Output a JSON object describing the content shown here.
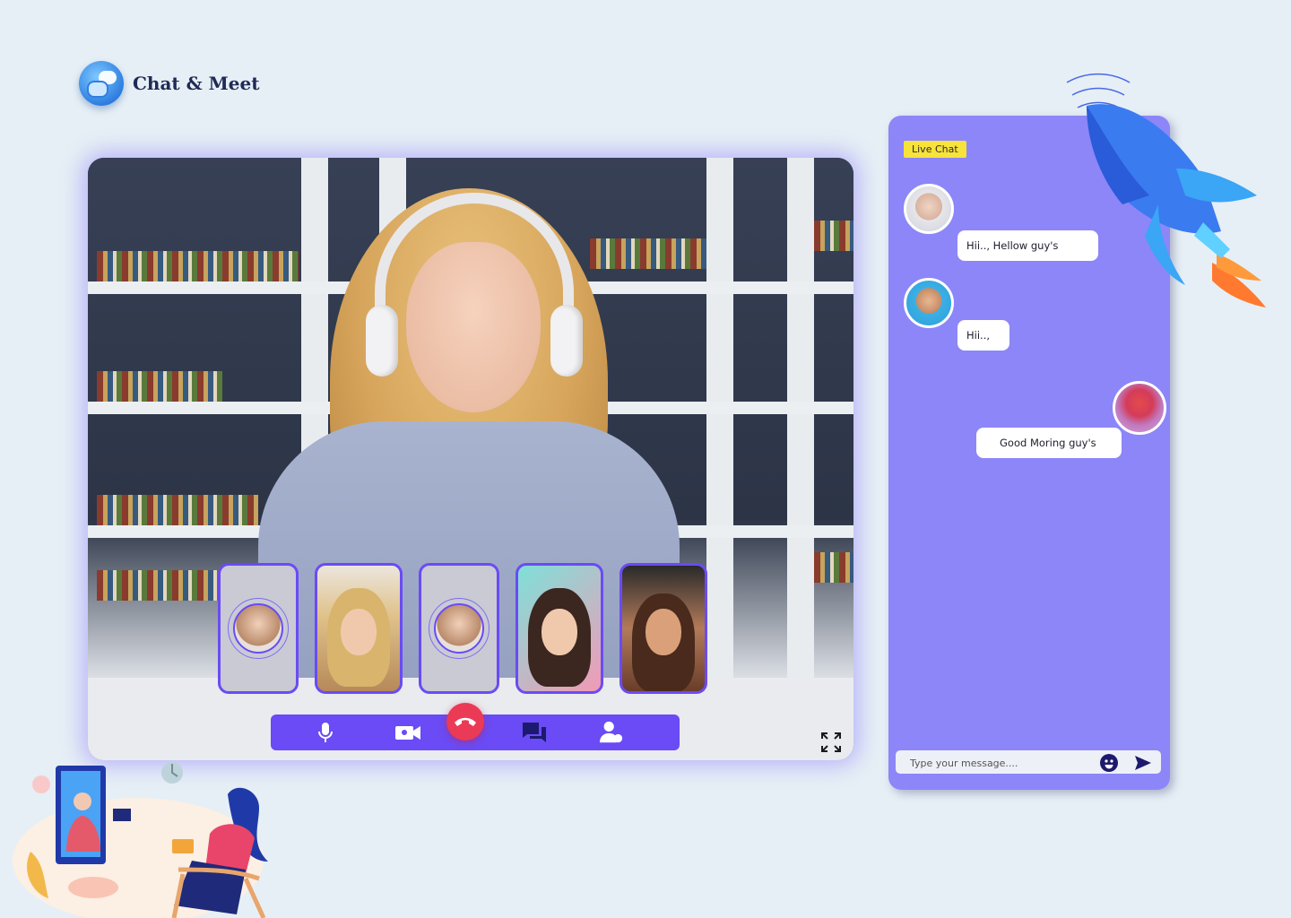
{
  "app": {
    "title": "Chat & Meet"
  },
  "chat": {
    "header": "Live Chat",
    "messages": [
      {
        "text": "Hii.., Hellow guy's",
        "side": "left"
      },
      {
        "text": "Hii..,",
        "side": "left"
      },
      {
        "text": "Good Moring guy's",
        "side": "right"
      }
    ],
    "input": {
      "placeholder": "Type your message....",
      "value": ""
    }
  },
  "call": {
    "participants": [
      "participant-1",
      "participant-2",
      "participant-3",
      "participant-4",
      "participant-5"
    ],
    "controls": [
      "mic",
      "camera",
      "end-call",
      "chat",
      "participants"
    ]
  },
  "colors": {
    "accent": "#6a4bf5",
    "chat_panel": "#8c86f8",
    "live_badge": "#f7e33a",
    "end_call": "#ea3a55",
    "background": "#e6eff5"
  },
  "icons": {
    "logo": "chat-bubbles-icon",
    "mic": "mic-icon",
    "camera": "video-camera-icon",
    "end_call": "phone-hangup-icon",
    "chat": "chat-icon",
    "participants": "person-add-icon",
    "fullscreen": "fullscreen-icon",
    "emoji": "emoji-icon",
    "send": "send-icon"
  }
}
